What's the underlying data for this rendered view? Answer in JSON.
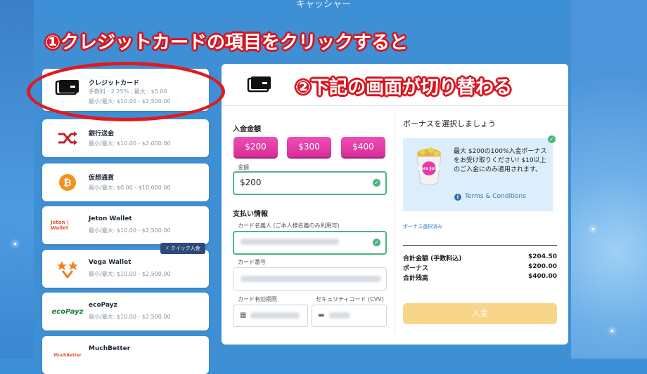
{
  "header": {
    "title": "キャッシャー"
  },
  "methods": [
    {
      "name": "クレジットカード",
      "fee": "手数料 : 2.25% , 最大 : $5.00",
      "limits": "最小/最大: $10.00 - $2,500.00",
      "icon": "credit-card-icon"
    },
    {
      "name": "銀行送金",
      "limits": "最小/最大: $10.00 - $2,000.00",
      "icon": "shuffle-icon"
    },
    {
      "name": "仮想通貨",
      "limits": "最小/最大: $0.00 - $10,000.00",
      "icon": "bitcoin-icon"
    },
    {
      "name": "Jeton Wallet",
      "limits": "最小/最大: $10.00 - $2,500.00",
      "logo_text": "Jeton | Wallet"
    },
    {
      "name": "Vega Wallet",
      "limits": "最小/最大: $10.00 - $2,500.00",
      "icon": "vega-logo-icon",
      "badge": "クイック入金"
    },
    {
      "name": "ecoPayz",
      "limits": "最小/最大: $10.00 - $2,500.00",
      "logo_text": "ecoPayz"
    },
    {
      "name": "MuchBetter",
      "logo_text": "MuchBetter"
    }
  ],
  "deposit": {
    "amount_heading": "入金金額",
    "preset_amounts": [
      "$200",
      "$300",
      "$400"
    ],
    "amount_label": "金額",
    "amount_value": "$200",
    "payment_heading": "支払い情報",
    "cardholder_label": "カード名義人 (ご本人様名義のみ利用可)",
    "card_number_label": "カード番号",
    "expiry_label": "カード有効期限",
    "cvv_label": "セキュリティコード (CVV)"
  },
  "bonus": {
    "heading": "ボーナスを選択しましょう",
    "text_line1": "最大 $200の100%入金ボーナスをお受け取りください! $10以上のご入金にのみ適用されます。",
    "terms_label": "Terms & Conditions",
    "selected_label": "ボーナス選択済み",
    "logo_text": "Vera John"
  },
  "summary": {
    "rows": [
      {
        "label": "合計金額 (手数料込)",
        "value": "$204.50"
      },
      {
        "label": "ボーナス",
        "value": "$200.00"
      },
      {
        "label": "合計残高",
        "value": "$400.00"
      }
    ],
    "deposit_button": "入金"
  },
  "annotations": {
    "step1": "①クレジットカードの項目をクリックすると",
    "step2": "②下記の画面が切り替わる"
  },
  "colors": {
    "accent_pink": "#e23da6",
    "success_green": "#4cb580",
    "annotation_red": "#d9141e",
    "deposit_yellow": "#f7d68a"
  }
}
